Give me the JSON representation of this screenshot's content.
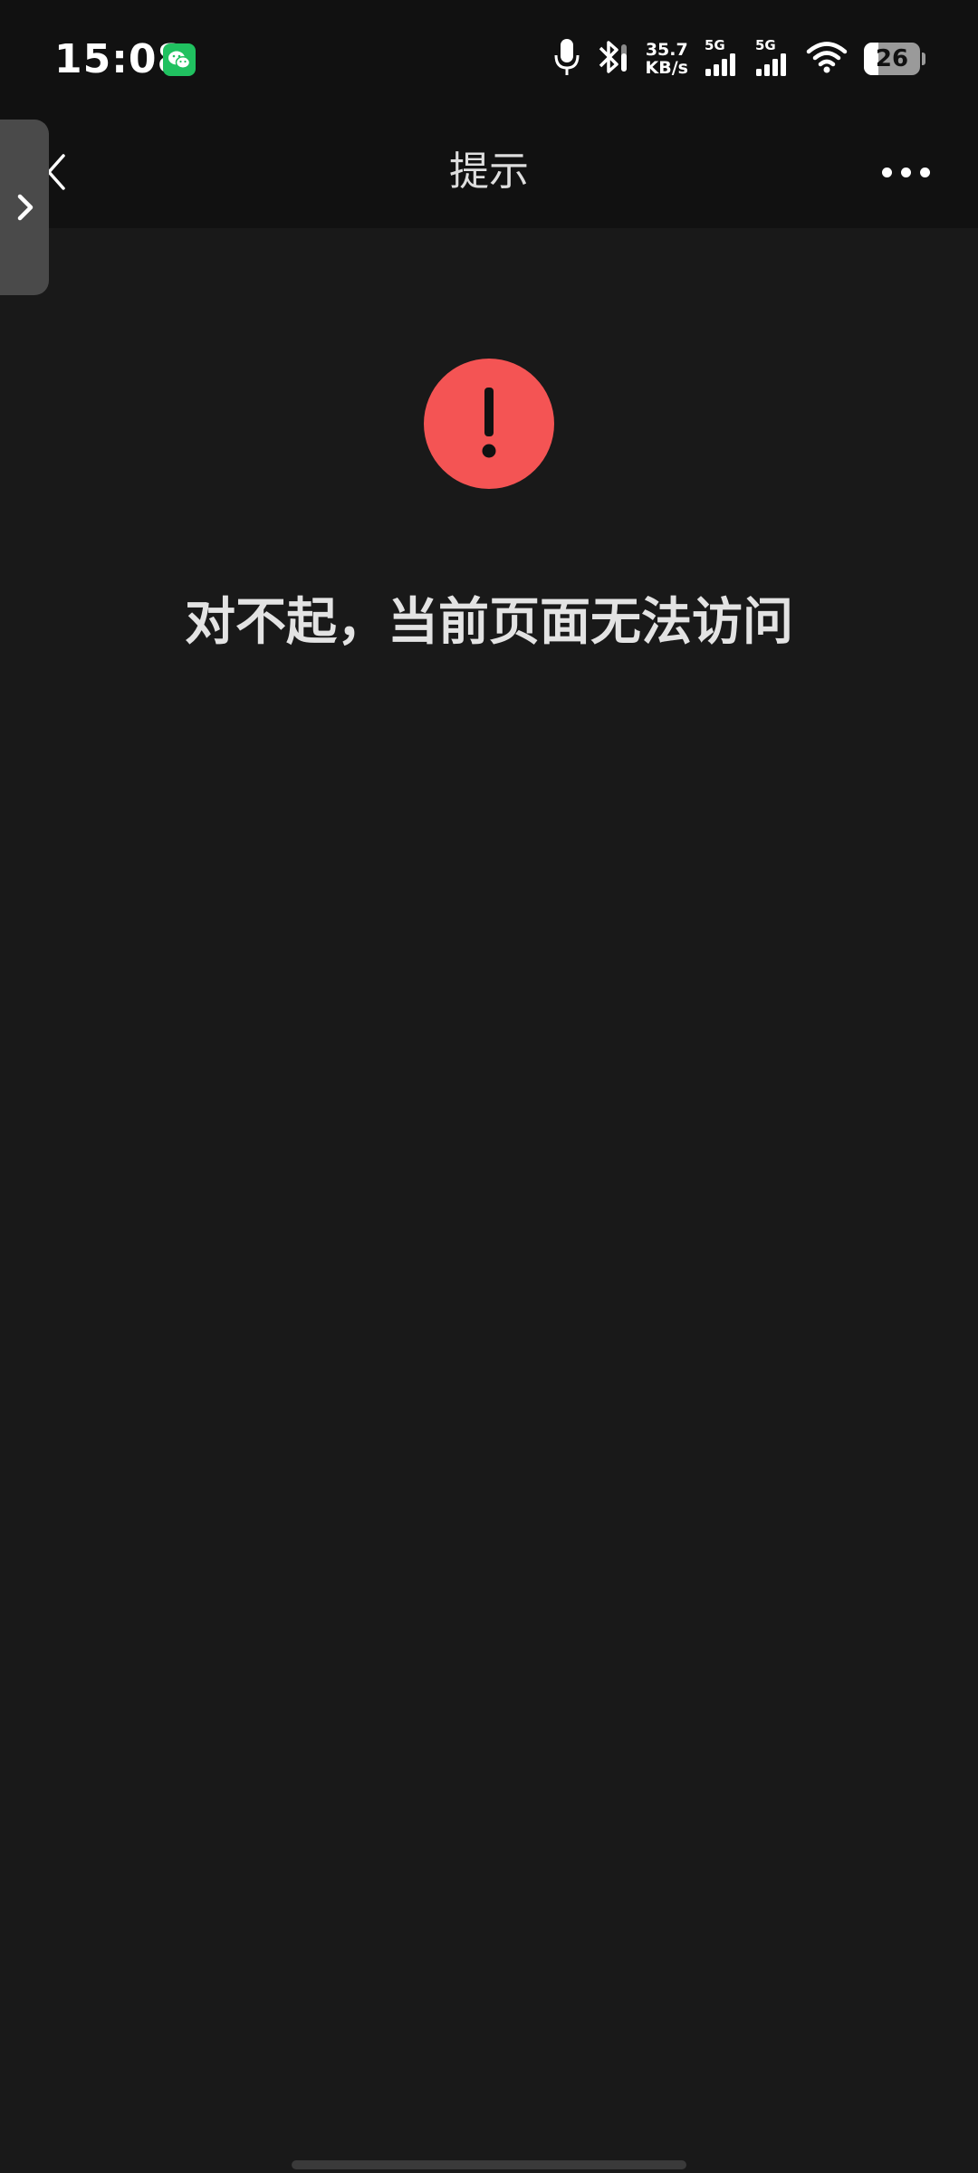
{
  "status_bar": {
    "time": "15:08",
    "net_speed_value": "35.7",
    "net_speed_unit": "KB/s",
    "sim1_label": "5G",
    "sim2_label": "5G",
    "battery_level": "26",
    "battery_fraction": 0.26,
    "icons": [
      "wechat-notification-icon",
      "microphone-icon",
      "bluetooth-icon",
      "signal-icon",
      "wifi-icon",
      "battery-icon"
    ]
  },
  "nav": {
    "title": "提示"
  },
  "content": {
    "message": "对不起，当前页面无法访问"
  },
  "colors": {
    "error": "#f45454",
    "background": "#191919",
    "bar": "#111111",
    "wechat": "#20c160"
  }
}
